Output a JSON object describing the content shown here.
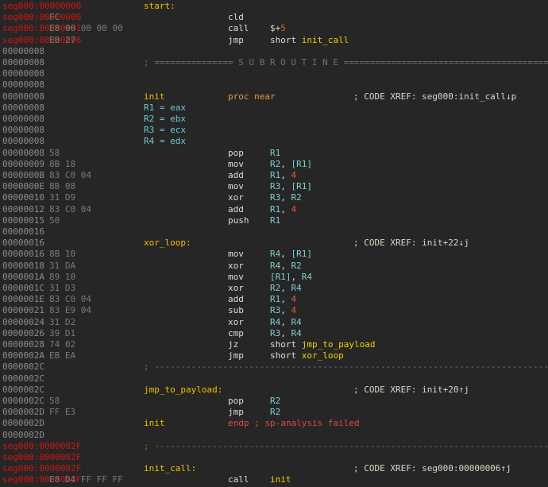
{
  "window": {
    "theme": "dark",
    "background": "#262626"
  },
  "lines": [
    {
      "addr": "seg000:00000000",
      "addr_red": true,
      "bytes": "",
      "label": "start:",
      "label_color": "label"
    },
    {
      "addr": "seg000:00000000",
      "addr_red": true,
      "bytes": "FC",
      "mnemonic": "cld"
    },
    {
      "addr": "seg000:00000001",
      "addr_red": true,
      "bytes": "E8 00 00 00 00",
      "mnemonic": "call",
      "operands": [
        {
          "t": "$+",
          "c": "plain"
        },
        {
          "t": "5",
          "c": "num"
        }
      ]
    },
    {
      "addr": "seg000:00000006",
      "addr_red": true,
      "bytes": "EB 27",
      "mnemonic": "jmp",
      "operands": [
        {
          "t": "short ",
          "c": "plain"
        },
        {
          "t": "init_call",
          "c": "sym"
        }
      ]
    },
    {
      "addr": "00000008"
    },
    {
      "addr": "00000008",
      "separator": "head",
      "sep_text": "; =============== S U B R O U T I N E ======================================="
    },
    {
      "addr": "00000008"
    },
    {
      "addr": "00000008"
    },
    {
      "addr": "00000008",
      "label": "init",
      "label_color": "label",
      "mnemonic": "proc near",
      "mnemonic_color": "dir",
      "comment": "; CODE XREF: seg000:init_call↓p"
    },
    {
      "addr": "00000008",
      "label": "R1 = eax",
      "label_color": "alias"
    },
    {
      "addr": "00000008",
      "label": "R2 = ebx",
      "label_color": "alias"
    },
    {
      "addr": "00000008",
      "label": "R3 = ecx",
      "label_color": "alias"
    },
    {
      "addr": "00000008",
      "label": "R4 = edx",
      "label_color": "alias"
    },
    {
      "addr": "00000008",
      "bytes": "58",
      "mnemonic": "pop",
      "operands": [
        {
          "t": "R1",
          "c": "reg"
        }
      ]
    },
    {
      "addr": "00000009",
      "bytes": "8B 18",
      "mnemonic": "mov",
      "operands": [
        {
          "t": "R2",
          "c": "reg"
        },
        {
          "t": ", ",
          "c": "plain"
        },
        {
          "t": "[R1]",
          "c": "reg"
        }
      ]
    },
    {
      "addr": "0000000B",
      "bytes": "83 C0 04",
      "mnemonic": "add",
      "operands": [
        {
          "t": "R1",
          "c": "reg"
        },
        {
          "t": ", ",
          "c": "plain"
        },
        {
          "t": "4",
          "c": "num"
        }
      ]
    },
    {
      "addr": "0000000E",
      "bytes": "8B 08",
      "mnemonic": "mov",
      "operands": [
        {
          "t": "R3",
          "c": "reg"
        },
        {
          "t": ", ",
          "c": "plain"
        },
        {
          "t": "[R1]",
          "c": "reg"
        }
      ]
    },
    {
      "addr": "00000010",
      "bytes": "31 D9",
      "mnemonic": "xor",
      "operands": [
        {
          "t": "R3",
          "c": "reg"
        },
        {
          "t": ", ",
          "c": "plain"
        },
        {
          "t": "R2",
          "c": "reg"
        }
      ]
    },
    {
      "addr": "00000012",
      "bytes": "83 C0 04",
      "mnemonic": "add",
      "operands": [
        {
          "t": "R1",
          "c": "reg"
        },
        {
          "t": ", ",
          "c": "plain"
        },
        {
          "t": "4",
          "c": "num"
        }
      ]
    },
    {
      "addr": "00000015",
      "bytes": "50",
      "mnemonic": "push",
      "operands": [
        {
          "t": "R1",
          "c": "reg"
        }
      ]
    },
    {
      "addr": "00000016"
    },
    {
      "addr": "00000016",
      "label": "xor_loop:",
      "label_color": "label",
      "comment": "; CODE XREF: init+22↓j"
    },
    {
      "addr": "00000016",
      "bytes": "8B 10",
      "mnemonic": "mov",
      "operands": [
        {
          "t": "R4",
          "c": "reg"
        },
        {
          "t": ", ",
          "c": "plain"
        },
        {
          "t": "[R1]",
          "c": "reg"
        }
      ]
    },
    {
      "addr": "00000018",
      "bytes": "31 DA",
      "mnemonic": "xor",
      "operands": [
        {
          "t": "R4",
          "c": "reg"
        },
        {
          "t": ", ",
          "c": "plain"
        },
        {
          "t": "R2",
          "c": "reg"
        }
      ]
    },
    {
      "addr": "0000001A",
      "bytes": "89 10",
      "mnemonic": "mov",
      "operands": [
        {
          "t": "[R1]",
          "c": "reg"
        },
        {
          "t": ", ",
          "c": "plain"
        },
        {
          "t": "R4",
          "c": "reg"
        }
      ]
    },
    {
      "addr": "0000001C",
      "bytes": "31 D3",
      "mnemonic": "xor",
      "operands": [
        {
          "t": "R2",
          "c": "reg"
        },
        {
          "t": ", ",
          "c": "plain"
        },
        {
          "t": "R4",
          "c": "reg"
        }
      ]
    },
    {
      "addr": "0000001E",
      "bytes": "83 C0 04",
      "mnemonic": "add",
      "operands": [
        {
          "t": "R1",
          "c": "reg"
        },
        {
          "t": ", ",
          "c": "plain"
        },
        {
          "t": "4",
          "c": "num"
        }
      ]
    },
    {
      "addr": "00000021",
      "bytes": "83 E9 04",
      "mnemonic": "sub",
      "operands": [
        {
          "t": "R3",
          "c": "reg"
        },
        {
          "t": ", ",
          "c": "plain"
        },
        {
          "t": "4",
          "c": "num"
        }
      ]
    },
    {
      "addr": "00000024",
      "bytes": "31 D2",
      "mnemonic": "xor",
      "operands": [
        {
          "t": "R4",
          "c": "reg"
        },
        {
          "t": ", ",
          "c": "plain"
        },
        {
          "t": "R4",
          "c": "reg"
        }
      ]
    },
    {
      "addr": "00000026",
      "bytes": "39 D1",
      "mnemonic": "cmp",
      "operands": [
        {
          "t": "R3",
          "c": "reg"
        },
        {
          "t": ", ",
          "c": "plain"
        },
        {
          "t": "R4",
          "c": "reg"
        }
      ]
    },
    {
      "addr": "00000028",
      "bytes": "74 02",
      "mnemonic": "jz",
      "operands": [
        {
          "t": "short ",
          "c": "plain"
        },
        {
          "t": "jmp_to_payload",
          "c": "sym"
        }
      ]
    },
    {
      "addr": "0000002A",
      "bytes": "EB EA",
      "mnemonic": "jmp",
      "operands": [
        {
          "t": "short ",
          "c": "plain"
        },
        {
          "t": "xor_loop",
          "c": "sym"
        }
      ]
    },
    {
      "addr": "0000002C",
      "separator": "dash",
      "sep_text": "; ---------------------------------------------------------------------------"
    },
    {
      "addr": "0000002C"
    },
    {
      "addr": "0000002C",
      "label": "jmp_to_payload:",
      "label_color": "label",
      "comment": "; CODE XREF: init+20↑j"
    },
    {
      "addr": "0000002C",
      "bytes": "58",
      "mnemonic": "pop",
      "operands": [
        {
          "t": "R2",
          "c": "reg"
        }
      ]
    },
    {
      "addr": "0000002D",
      "bytes": "FF E3",
      "mnemonic": "jmp",
      "operands": [
        {
          "t": "R2",
          "c": "reg"
        }
      ]
    },
    {
      "addr": "0000002D",
      "label": "init",
      "label_color": "label",
      "mnemonic": "endp ; sp-analysis failed",
      "mnemonic_color": "dirtext"
    },
    {
      "addr": "0000002D"
    },
    {
      "addr": "seg000:0000002F",
      "addr_red": true,
      "separator": "dash",
      "sep_text": "; ---------------------------------------------------------------------------"
    },
    {
      "addr": "seg000:0000002F",
      "addr_red": true
    },
    {
      "addr": "seg000:0000002F",
      "addr_red": true,
      "label": "init_call:",
      "label_color": "label",
      "comment": "; CODE XREF: seg000:00000006↑j"
    },
    {
      "addr": "seg000:0000002F",
      "addr_red": true,
      "bytes": "E8 D4 FF FF FF",
      "mnemonic": "call",
      "operands": [
        {
          "t": "init",
          "c": "sym"
        }
      ]
    }
  ]
}
